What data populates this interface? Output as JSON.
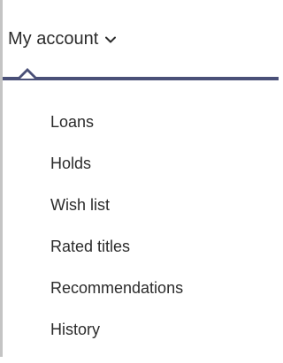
{
  "account_menu": {
    "toggle_label": "My account",
    "toggle_icon": "chevron-down-icon",
    "accent_color": "#4a5078",
    "items": [
      {
        "label": "Loans"
      },
      {
        "label": "Holds"
      },
      {
        "label": "Wish list"
      },
      {
        "label": "Rated titles"
      },
      {
        "label": "Recommendations"
      },
      {
        "label": "History"
      }
    ]
  }
}
